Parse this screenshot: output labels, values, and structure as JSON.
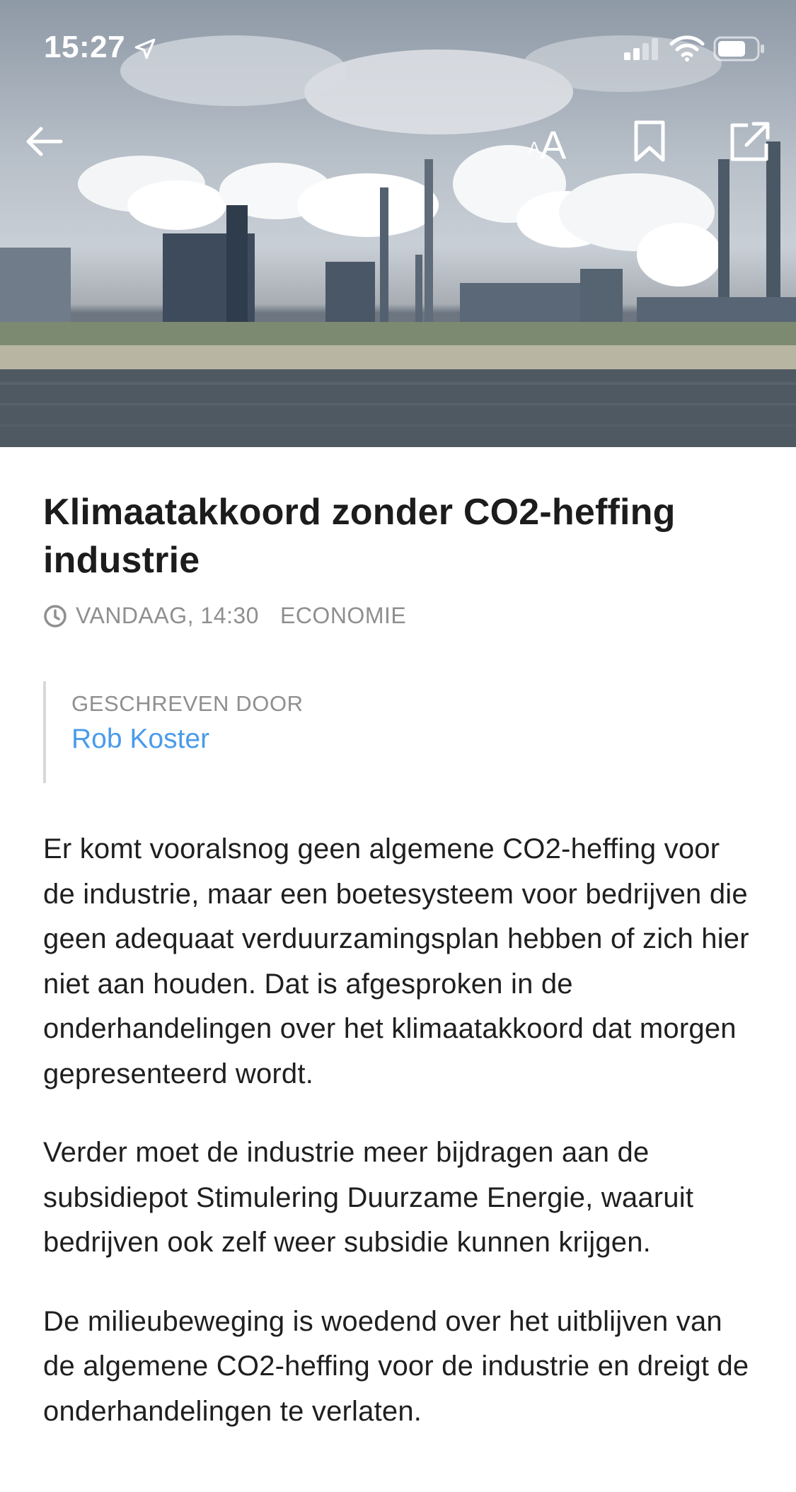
{
  "status_bar": {
    "time": "15:27"
  },
  "icons": {
    "location": "location-arrow-icon",
    "signal": "cellular-signal-icon",
    "wifi": "wifi-icon",
    "battery": "battery-icon",
    "back": "arrow-left-icon",
    "text_size": "text-size-icon",
    "bookmark": "bookmark-icon",
    "share": "share-external-icon",
    "clock": "clock-icon"
  },
  "toolbar": {
    "text_size_small": "A",
    "text_size_large": "A"
  },
  "article": {
    "title": "Klimaatakkoord zonder CO2-heffing industrie",
    "published": "VANDAAG, 14:30",
    "category": "ECONOMIE",
    "author_label": "GESCHREVEN DOOR",
    "author_name": "Rob Koster",
    "paragraphs": [
      "Er komt vooralsnog geen algemene CO2-heffing voor de industrie, maar een boetesysteem voor bedrijven die geen adequaat verduurzamingsplan hebben of zich hier niet aan houden. Dat is afgesproken in de onderhandelingen over het klimaatakkoord dat morgen gepresenteerd wordt.",
      "Verder moet de industrie meer bijdragen aan de subsidiepot Stimulering Duurzame Energie, waaruit bedrijven ook zelf weer subsidie kunnen krijgen.",
      "De milieubeweging is woedend over het uitblijven van de algemene CO2-heffing voor de industrie en dreigt de onderhandelingen te verlaten."
    ]
  },
  "colors": {
    "link": "#4a9bea",
    "muted": "#8f8f8f",
    "text": "#1f1f1f"
  }
}
